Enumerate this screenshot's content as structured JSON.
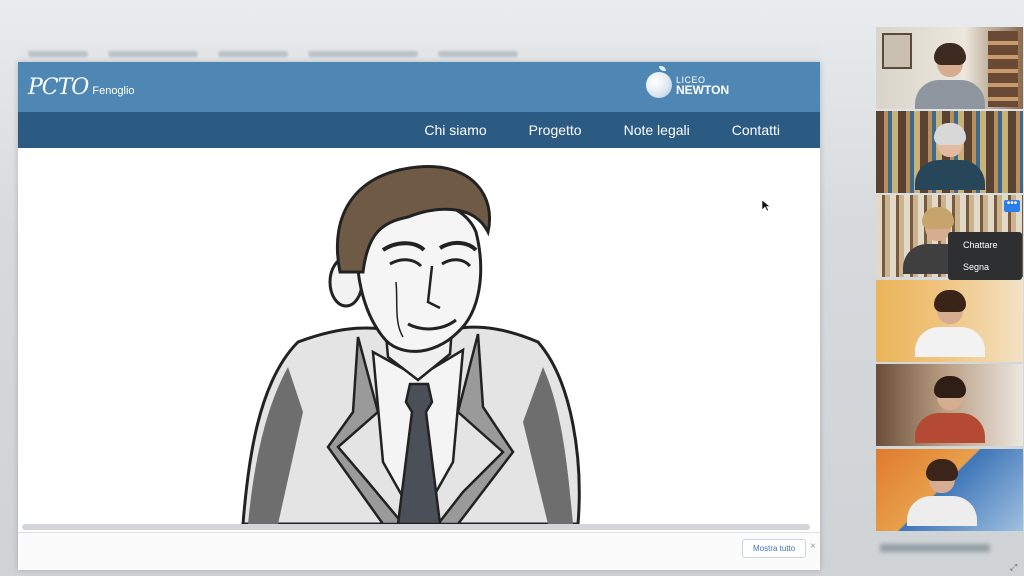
{
  "site": {
    "brand_main": "PCTO",
    "brand_sub": "Fenoglio",
    "logo_top": "LICEO",
    "logo_bottom": "NEWTON",
    "nav": [
      "Chi siamo",
      "Progetto",
      "Note legali",
      "Contatti"
    ],
    "show_all_label": "Mostra tutto",
    "close_label": "×"
  },
  "participants_menu": {
    "more_label": "•••",
    "items": [
      "Chattare",
      "Segna"
    ]
  },
  "colors": {
    "header": "#4e87b4",
    "nav": "#2b5a82",
    "accent": "#2b7de9"
  }
}
